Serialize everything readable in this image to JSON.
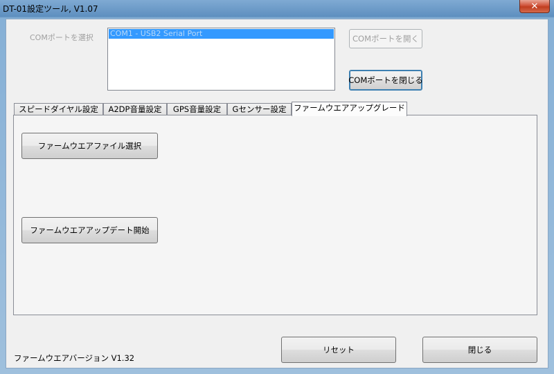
{
  "window": {
    "title": "DT-01設定ツール, V1.07",
    "close_label": "✕"
  },
  "com": {
    "label": "COMポートを選択",
    "list_items": [
      "COM1 - USB2 Serial Port"
    ],
    "open_button": "COMポートを開く",
    "close_button": "COMポートを閉じる"
  },
  "tabs": [
    {
      "label": "スピードダイヤル設定"
    },
    {
      "label": "A2DP音量設定"
    },
    {
      "label": "GPS音量設定"
    },
    {
      "label": "Gセンサー設定"
    },
    {
      "label": "ファームウエアアップグレード"
    }
  ],
  "firmware": {
    "select_button": "ファームウエアファイル選択",
    "start_button": "ファームウエアアップデート開始"
  },
  "footer": {
    "version": "ファームウエアバージョン V1.32",
    "reset_button": "リセット",
    "close_button": "閉じる"
  }
}
